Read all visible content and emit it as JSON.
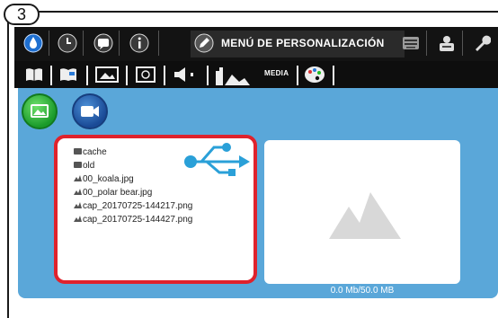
{
  "step": "3",
  "topbar": {
    "title": "MENÚ DE PERSONALIZACIÓN",
    "icons": [
      "ink-drop-icon",
      "clock-icon",
      "chat-icon",
      "info-icon",
      "pencil-icon",
      "keyboard-icon",
      "printer-icon",
      "wrench-icon"
    ]
  },
  "subbar": {
    "active_tab": "MEDIA",
    "icons": [
      "book-icon",
      "book-highlight-icon",
      "picture-frame-icon",
      "tag-icon",
      "speaker-icon",
      "media-icon",
      "palette-icon"
    ]
  },
  "media": {
    "modes": [
      "image-mode",
      "video-mode"
    ],
    "files": [
      {
        "type": "folder",
        "name": "cache"
      },
      {
        "type": "folder",
        "name": "old"
      },
      {
        "type": "image",
        "name": "00_koala.jpg"
      },
      {
        "type": "image",
        "name": "00_polar bear.jpg"
      },
      {
        "type": "image",
        "name": "cap_20170725-144217.png"
      },
      {
        "type": "image",
        "name": "cap_20170725-144427.png"
      }
    ],
    "storage": "0.0 Mb/50.0 MB"
  },
  "colors": {
    "panel": "#5aa7d9",
    "highlight": "#e0222c",
    "usb": "#2aa0d8"
  }
}
